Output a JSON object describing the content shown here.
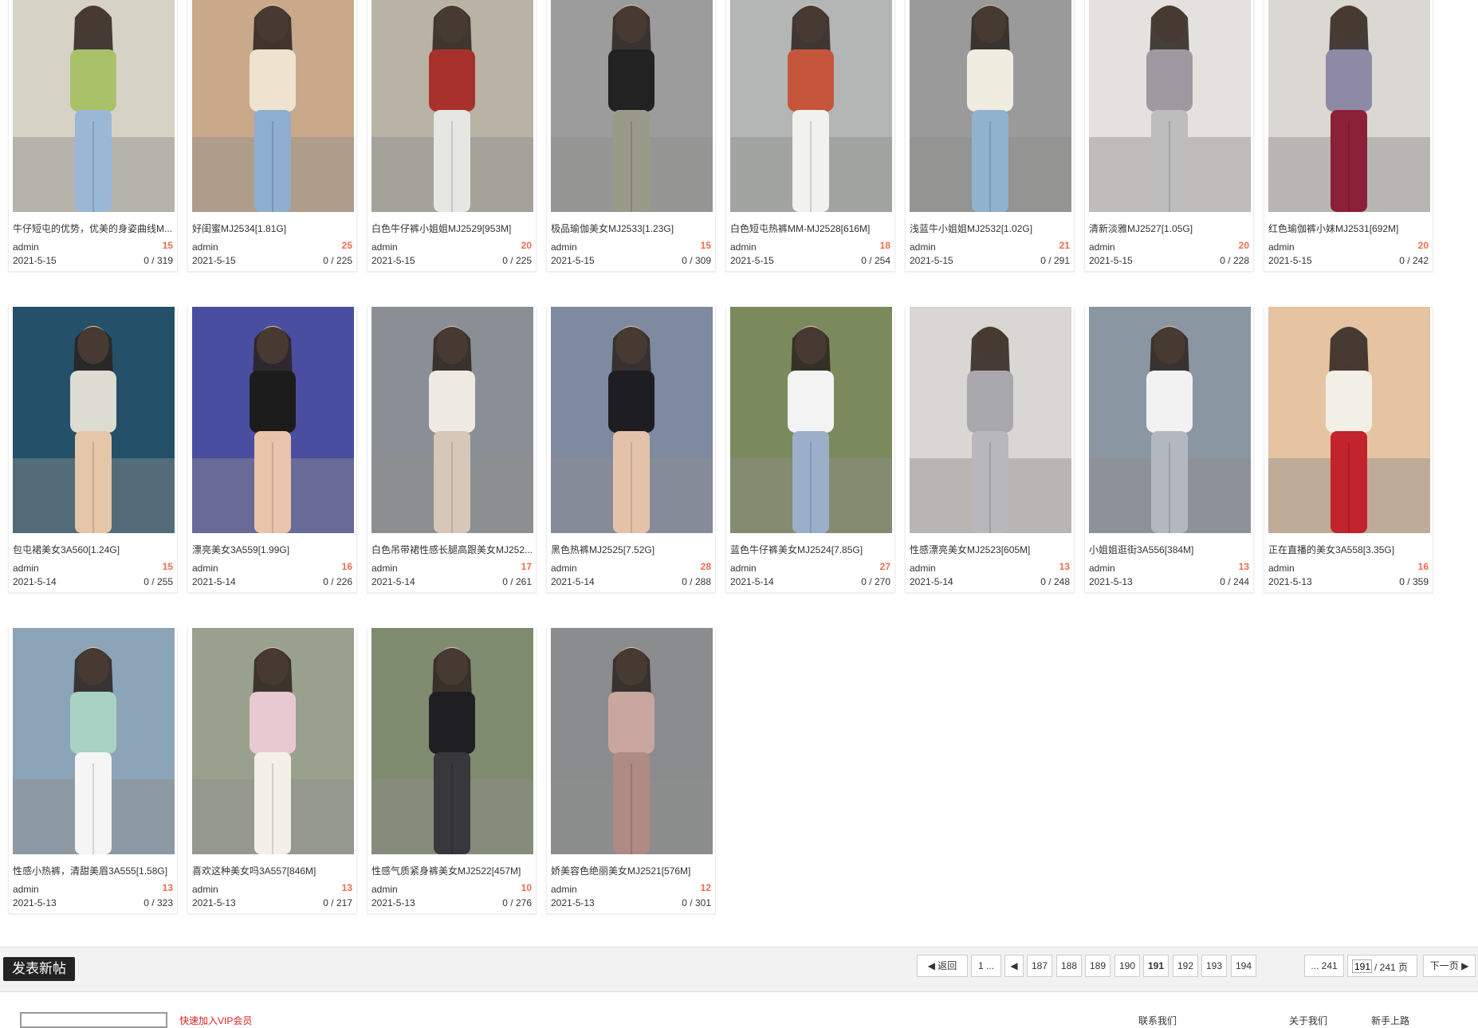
{
  "posts": [
    {
      "title": "牛仔短屯的优势，优美的身姿曲线M...",
      "author": "admin",
      "replies": "15",
      "date": "2021-5-15",
      "views": "0 / 319",
      "palette": [
        "#a9c26a",
        "#9bb7d6",
        "#d7d2c6"
      ]
    },
    {
      "title": "好闺蜜MJ2534[1.81G]",
      "author": "admin",
      "replies": "25",
      "date": "2021-5-15",
      "views": "0 / 225",
      "palette": [
        "#efe3cf",
        "#8eaed0",
        "#c9a98a"
      ]
    },
    {
      "title": "白色牛仔裤小姐姐MJ2529[953M]",
      "author": "admin",
      "replies": "20",
      "date": "2021-5-15",
      "views": "0 / 225",
      "palette": [
        "#a8312c",
        "#e6e6e2",
        "#b9b3a6"
      ]
    },
    {
      "title": "极品瑜伽美女MJ2533[1.23G]",
      "author": "admin",
      "replies": "15",
      "date": "2021-5-15",
      "views": "0 / 309",
      "palette": [
        "#222222",
        "#9a9a8a",
        "#9c9c9c"
      ]
    },
    {
      "title": "白色短屯热裤MM-MJ2528[616M]",
      "author": "admin",
      "replies": "18",
      "date": "2021-5-15",
      "views": "0 / 254",
      "palette": [
        "#c5563c",
        "#f1f1ee",
        "#b3b6b5"
      ]
    },
    {
      "title": "浅蓝牛小姐姐MJ2532[1.02G]",
      "author": "admin",
      "replies": "21",
      "date": "2021-5-15",
      "views": "0 / 291",
      "palette": [
        "#f0ece0",
        "#8fb2cf",
        "#9a9a9a"
      ]
    },
    {
      "title": "清新淡雅MJ2527[1.05G]",
      "author": "admin",
      "replies": "20",
      "date": "2021-5-15",
      "views": "0 / 228",
      "palette": [
        "#9c9aa0",
        "#bdbdbd",
        "#e4e2de"
      ]
    },
    {
      "title": "红色瑜伽裤小妹MJ2531[692M]",
      "author": "admin",
      "replies": "20",
      "date": "2021-5-15",
      "views": "0 / 242",
      "palette": [
        "#8e8aa6",
        "#8c2038",
        "#dad8d3"
      ]
    },
    {
      "title": "包屯裙美女3A560[1.24G]",
      "author": "admin",
      "replies": "15",
      "date": "2021-5-14",
      "views": "0 / 255",
      "palette": [
        "#dcdcd2",
        "#e5c6a8",
        "#24506a"
      ]
    },
    {
      "title": "漂亮美女3A559[1.99G]",
      "author": "admin",
      "replies": "16",
      "date": "2021-5-14",
      "views": "0 / 226",
      "palette": [
        "#1c1c1c",
        "#e9c3aa",
        "#4a4ea0"
      ]
    },
    {
      "title": "白色吊带裙性感长腿高跟美女MJ252...",
      "author": "admin",
      "replies": "17",
      "date": "2021-5-14",
      "views": "0 / 261",
      "palette": [
        "#eeeae2",
        "#d6c7b9",
        "#8a8f95"
      ]
    },
    {
      "title": "黑色热裤MJ2525[7.52G]",
      "author": "admin",
      "replies": "28",
      "date": "2021-5-14",
      "views": "0 / 288",
      "palette": [
        "#1e1e22",
        "#e4c2aa",
        "#7e8aa0"
      ]
    },
    {
      "title": "蓝色牛仔裤美女MJ2524[7.85G]",
      "author": "admin",
      "replies": "27",
      "date": "2021-5-14",
      "views": "0 / 270",
      "palette": [
        "#f3f3f3",
        "#9bb0c8",
        "#7b8a5c"
      ]
    },
    {
      "title": "性感漂亮美女MJ2523[605M]",
      "author": "admin",
      "replies": "13",
      "date": "2021-5-14",
      "views": "0 / 248",
      "palette": [
        "#a9a7ae",
        "#b8b7bb",
        "#d9d7d3"
      ]
    },
    {
      "title": "小姐姐逛街3A556[384M]",
      "author": "admin",
      "replies": "13",
      "date": "2021-5-13",
      "views": "0 / 244",
      "palette": [
        "#f2f2f2",
        "#b3b8c0",
        "#8a96a2"
      ]
    },
    {
      "title": "正在直播的美女3A558[3.35G]",
      "author": "admin",
      "replies": "16",
      "date": "2021-5-13",
      "views": "0 / 359",
      "palette": [
        "#f1efe6",
        "#c2232c",
        "#e6c4a2"
      ]
    },
    {
      "title": "性感小热裤，清甜美眉3A555[1.58G]",
      "author": "admin",
      "replies": "13",
      "date": "2021-5-13",
      "views": "0 / 323",
      "palette": [
        "#a8d2c4",
        "#f5f5f5",
        "#8ca4b8"
      ]
    },
    {
      "title": "喜欢这种美女吗3A557[846M]",
      "author": "admin",
      "replies": "13",
      "date": "2021-5-13",
      "views": "0 / 217",
      "palette": [
        "#e8c9d2",
        "#f3f0e8",
        "#9aa08e"
      ]
    },
    {
      "title": "性感气质紧身裤美女MJ2522[457M]",
      "author": "admin",
      "replies": "10",
      "date": "2021-5-13",
      "views": "0 / 276",
      "palette": [
        "#1f1f22",
        "#38383c",
        "#7e8b6e"
      ]
    },
    {
      "title": "娇美容色绝丽美女MJ2521[576M]",
      "author": "admin",
      "replies": "12",
      "date": "2021-5-13",
      "views": "0 / 301",
      "palette": [
        "#c9a6a0",
        "#b08a84",
        "#8a8c8e"
      ]
    }
  ],
  "toolbar": {
    "new_post_label": "发表新帖"
  },
  "pagination": {
    "back_label": "返回",
    "first_label": "1 ...",
    "pages": [
      "187",
      "188",
      "189",
      "190",
      "191",
      "192",
      "193",
      "194"
    ],
    "current": "191",
    "last_label": "... 241",
    "input_value": "191",
    "total_label": "/ 241 页",
    "next_label": "下一页"
  },
  "footer": {
    "peek_left": "快速加入VIP会员",
    "peek_mid": "联系我们",
    "peek_right1": "关于我们",
    "peek_right2": "新手上路"
  },
  "colors": {
    "accent_red": "#f26c4f",
    "button_dark": "#222222",
    "bar_bg": "#f2f2f2"
  }
}
